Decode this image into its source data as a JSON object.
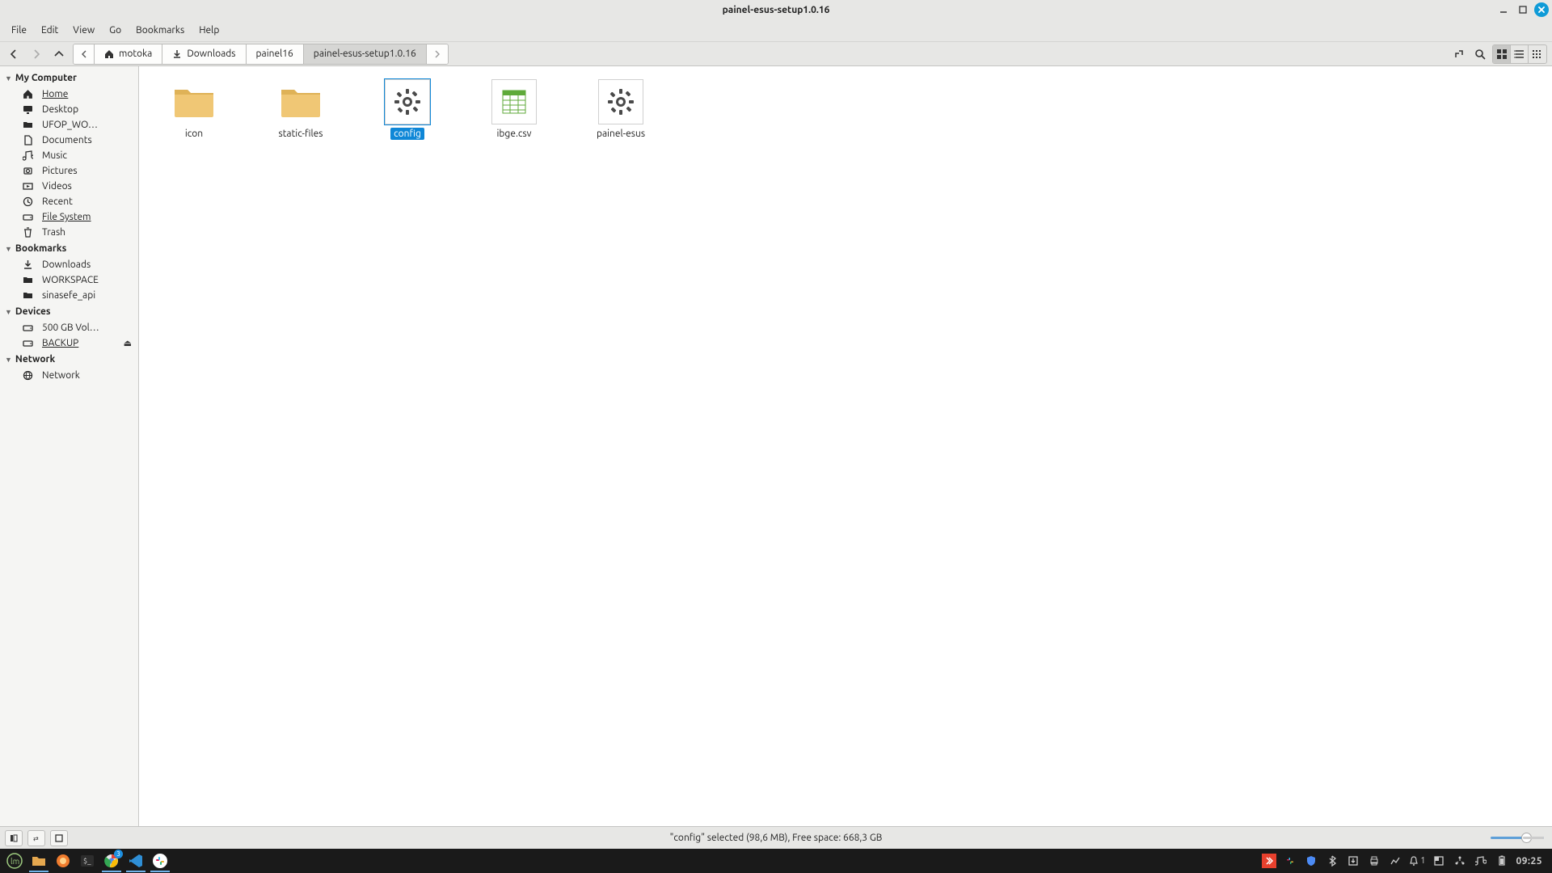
{
  "window": {
    "title": "painel-esus-setup1.0.16"
  },
  "menubar": [
    "File",
    "Edit",
    "View",
    "Go",
    "Bookmarks",
    "Help"
  ],
  "breadcrumb": {
    "segments": [
      {
        "label": "motoka",
        "icon": "home"
      },
      {
        "label": "Downloads",
        "icon": "download"
      },
      {
        "label": "painel16",
        "icon": null
      },
      {
        "label": "painel-esus-setup1.0.16",
        "icon": null,
        "active": true
      }
    ]
  },
  "sidebar": {
    "sections": [
      {
        "title": "My Computer",
        "items": [
          {
            "label": "Home",
            "icon": "home",
            "underlined": true
          },
          {
            "label": "Desktop",
            "icon": "desktop"
          },
          {
            "label": "UFOP_WO…",
            "icon": "folder"
          },
          {
            "label": "Documents",
            "icon": "document"
          },
          {
            "label": "Music",
            "icon": "music"
          },
          {
            "label": "Pictures",
            "icon": "pictures"
          },
          {
            "label": "Videos",
            "icon": "videos"
          },
          {
            "label": "Recent",
            "icon": "recent"
          },
          {
            "label": "File System",
            "icon": "disk",
            "underlined": true
          },
          {
            "label": "Trash",
            "icon": "trash"
          }
        ]
      },
      {
        "title": "Bookmarks",
        "items": [
          {
            "label": "Downloads",
            "icon": "download"
          },
          {
            "label": "WORKSPACE",
            "icon": "folder"
          },
          {
            "label": "sinasefe_api",
            "icon": "folder"
          }
        ]
      },
      {
        "title": "Devices",
        "items": [
          {
            "label": "500 GB Vol…",
            "icon": "disk"
          },
          {
            "label": "BACKUP",
            "icon": "disk",
            "underlined": true,
            "eject": true
          }
        ]
      },
      {
        "title": "Network",
        "items": [
          {
            "label": "Network",
            "icon": "network"
          }
        ]
      }
    ]
  },
  "files": [
    {
      "name": "icon",
      "type": "folder"
    },
    {
      "name": "static-files",
      "type": "folder"
    },
    {
      "name": "config",
      "type": "exec",
      "selected": true
    },
    {
      "name": "ibge.csv",
      "type": "spreadsheet"
    },
    {
      "name": "painel-esus",
      "type": "exec"
    }
  ],
  "statusbar": {
    "text": "\"config\" selected (98,6 MB), Free space: 668,3 GB"
  },
  "taskbar": {
    "chrome_badge": "3",
    "tray_count": "1",
    "clock": "09:25"
  }
}
